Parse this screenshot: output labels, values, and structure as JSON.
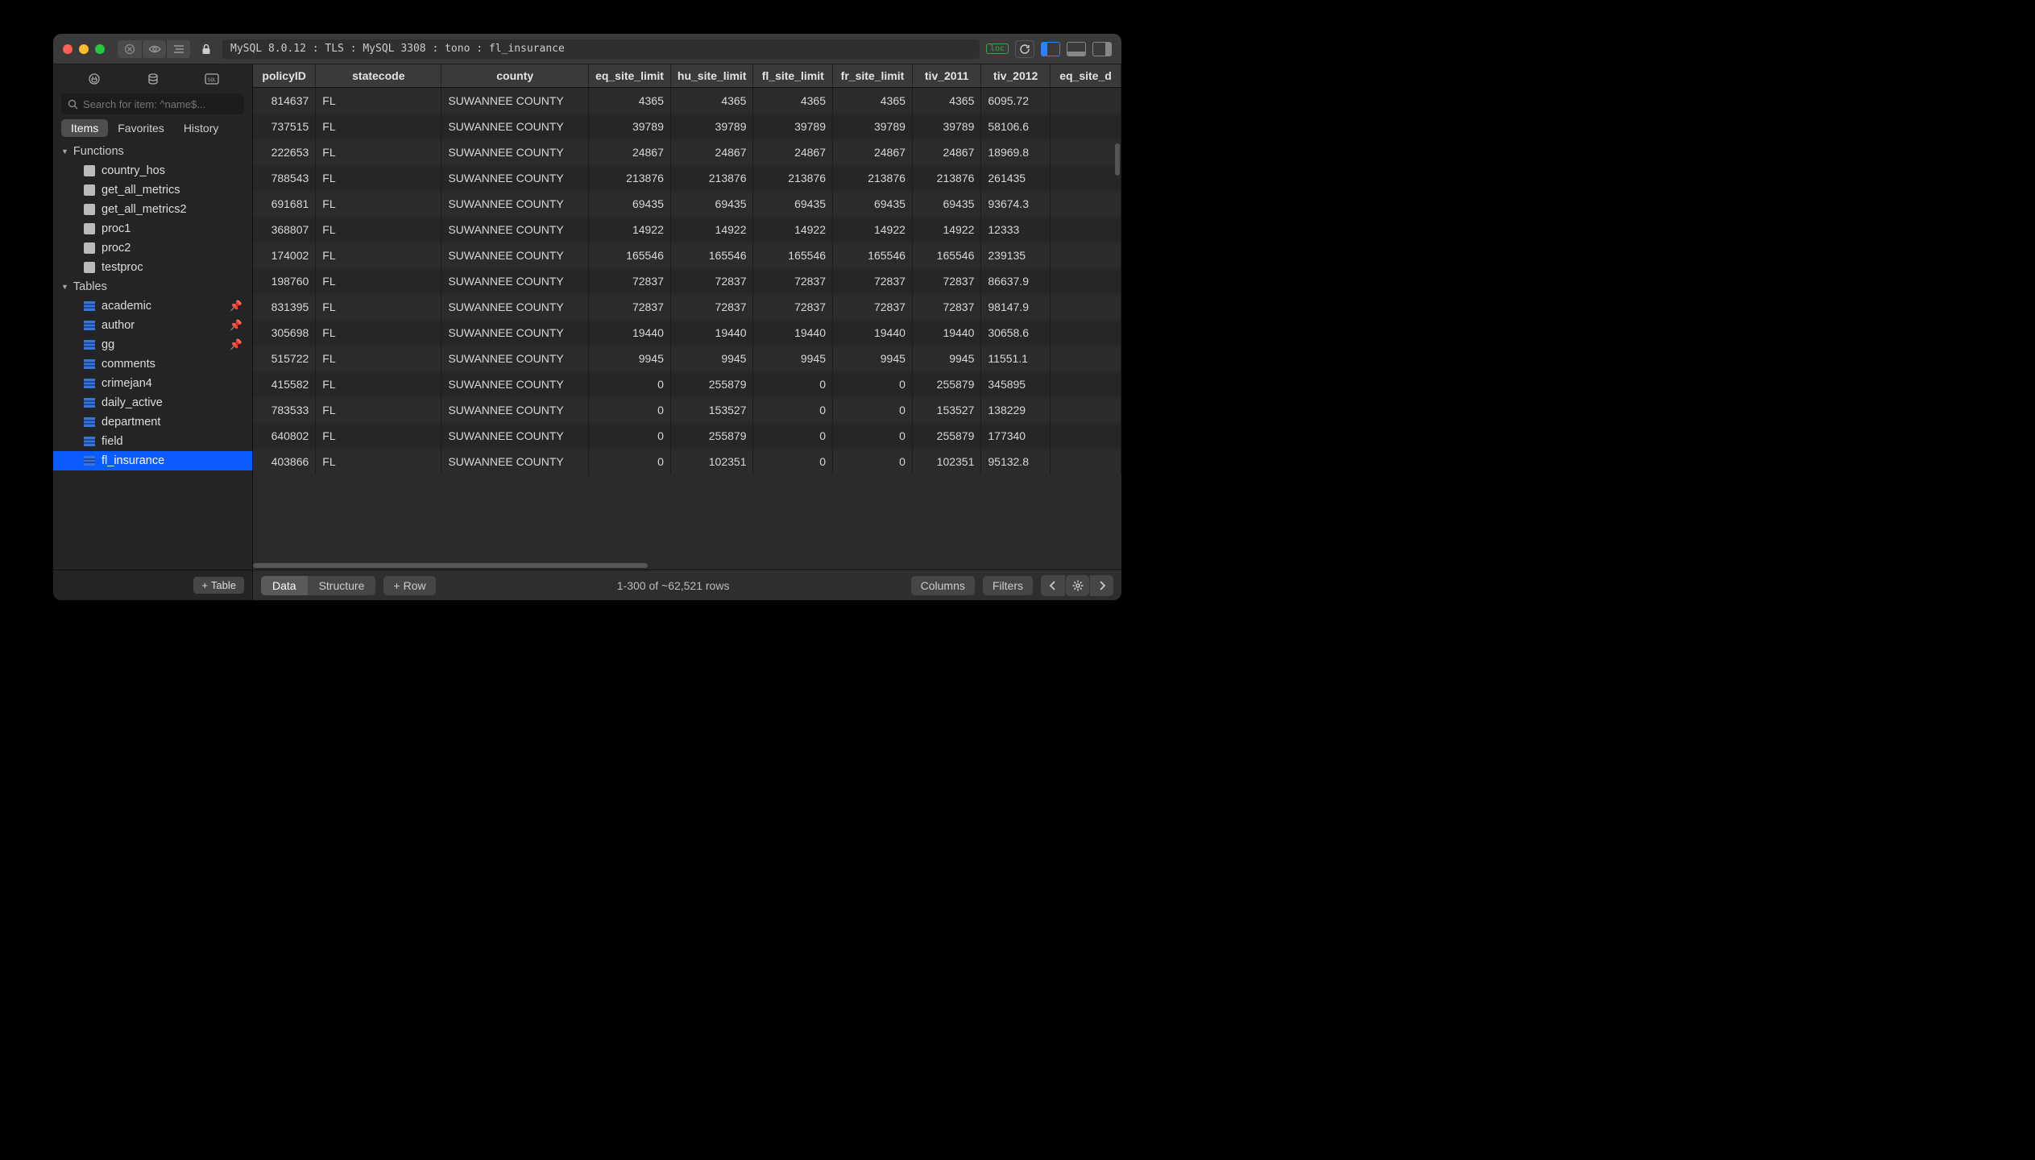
{
  "titlebar": {
    "connection": "MySQL 8.0.12 : TLS : MySQL 3308 : tono : fl_insurance",
    "loc_badge": "loc"
  },
  "sidebar": {
    "search_placeholder": "Search for item: ^name$...",
    "tabs": {
      "items": "Items",
      "favorites": "Favorites",
      "history": "History"
    },
    "sections": {
      "functions": {
        "label": "Functions",
        "items": [
          "country_hos",
          "get_all_metrics",
          "get_all_metrics2",
          "proc1",
          "proc2",
          "testproc"
        ]
      },
      "tables": {
        "label": "Tables",
        "items": [
          {
            "name": "academic",
            "pinned": true
          },
          {
            "name": "author",
            "pinned": true
          },
          {
            "name": "gg",
            "pinned": true
          },
          {
            "name": "comments",
            "pinned": false
          },
          {
            "name": "crimejan4",
            "pinned": false
          },
          {
            "name": "daily_active",
            "pinned": false
          },
          {
            "name": "department",
            "pinned": false
          },
          {
            "name": "field",
            "pinned": false
          },
          {
            "name": "fl_insurance",
            "pinned": false,
            "selected": true
          }
        ]
      }
    },
    "add_table": "Table"
  },
  "grid": {
    "columns": [
      "policyID",
      "statecode",
      "county",
      "eq_site_limit",
      "hu_site_limit",
      "fl_site_limit",
      "fr_site_limit",
      "tiv_2011",
      "tiv_2012",
      "eq_site_d"
    ],
    "col_align": [
      "num",
      "txt",
      "txt",
      "num",
      "num",
      "num",
      "num",
      "num",
      "txt",
      "txt"
    ],
    "rows": [
      [
        "814637",
        "FL",
        "SUWANNEE COUNTY",
        "4365",
        "4365",
        "4365",
        "4365",
        "4365",
        "6095.72",
        ""
      ],
      [
        "737515",
        "FL",
        "SUWANNEE COUNTY",
        "39789",
        "39789",
        "39789",
        "39789",
        "39789",
        "58106.6",
        ""
      ],
      [
        "222653",
        "FL",
        "SUWANNEE COUNTY",
        "24867",
        "24867",
        "24867",
        "24867",
        "24867",
        "18969.8",
        ""
      ],
      [
        "788543",
        "FL",
        "SUWANNEE COUNTY",
        "213876",
        "213876",
        "213876",
        "213876",
        "213876",
        "261435",
        ""
      ],
      [
        "691681",
        "FL",
        "SUWANNEE COUNTY",
        "69435",
        "69435",
        "69435",
        "69435",
        "69435",
        "93674.3",
        ""
      ],
      [
        "368807",
        "FL",
        "SUWANNEE COUNTY",
        "14922",
        "14922",
        "14922",
        "14922",
        "14922",
        "12333",
        ""
      ],
      [
        "174002",
        "FL",
        "SUWANNEE COUNTY",
        "165546",
        "165546",
        "165546",
        "165546",
        "165546",
        "239135",
        ""
      ],
      [
        "198760",
        "FL",
        "SUWANNEE COUNTY",
        "72837",
        "72837",
        "72837",
        "72837",
        "72837",
        "86637.9",
        ""
      ],
      [
        "831395",
        "FL",
        "SUWANNEE COUNTY",
        "72837",
        "72837",
        "72837",
        "72837",
        "72837",
        "98147.9",
        ""
      ],
      [
        "305698",
        "FL",
        "SUWANNEE COUNTY",
        "19440",
        "19440",
        "19440",
        "19440",
        "19440",
        "30658.6",
        ""
      ],
      [
        "515722",
        "FL",
        "SUWANNEE COUNTY",
        "9945",
        "9945",
        "9945",
        "9945",
        "9945",
        "11551.1",
        ""
      ],
      [
        "415582",
        "FL",
        "SUWANNEE COUNTY",
        "0",
        "255879",
        "0",
        "0",
        "255879",
        "345895",
        ""
      ],
      [
        "783533",
        "FL",
        "SUWANNEE COUNTY",
        "0",
        "153527",
        "0",
        "0",
        "153527",
        "138229",
        ""
      ],
      [
        "640802",
        "FL",
        "SUWANNEE COUNTY",
        "0",
        "255879",
        "0",
        "0",
        "255879",
        "177340",
        ""
      ],
      [
        "403866",
        "FL",
        "SUWANNEE COUNTY",
        "0",
        "102351",
        "0",
        "0",
        "102351",
        "95132.8",
        ""
      ]
    ]
  },
  "footer": {
    "data": "Data",
    "structure": "Structure",
    "row": "Row",
    "status": "1-300 of ~62,521 rows",
    "columns": "Columns",
    "filters": "Filters"
  }
}
